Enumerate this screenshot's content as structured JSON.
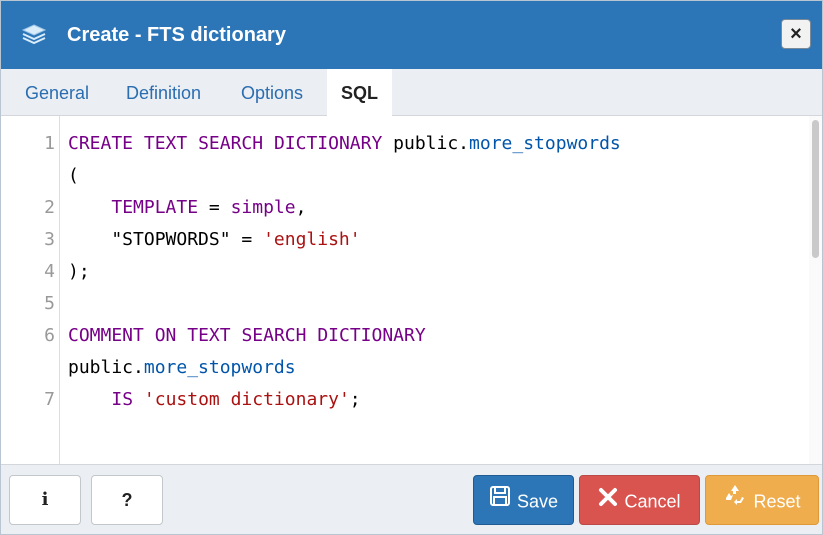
{
  "dialog": {
    "title": "Create - FTS dictionary",
    "close_label": "×"
  },
  "tabs": [
    {
      "label": "General"
    },
    {
      "label": "Definition"
    },
    {
      "label": "Options"
    },
    {
      "label": "SQL",
      "active": true
    }
  ],
  "editor": {
    "line_numbers": [
      "1",
      "2",
      "3",
      "4",
      "5",
      "6",
      "7"
    ],
    "lines": [
      "CREATE TEXT SEARCH DICTIONARY public.more_stopwords",
      "(",
      "    TEMPLATE = simple,",
      "    \"STOPWORDS\" = 'english'",
      ");",
      "",
      "COMMENT ON TEXT SEARCH DICTIONARY",
      "public.more_stopwords",
      "    IS 'custom dictionary';"
    ]
  },
  "footer": {
    "info_label": "i",
    "help_label": "?",
    "save_label": "Save",
    "cancel_label": "Cancel",
    "reset_label": "Reset"
  },
  "colors": {
    "titlebar": "#2c76b8",
    "keyword": "#770088",
    "string": "#aa1111",
    "definition": "#0055aa",
    "save": "#2c76b8",
    "cancel": "#d9534f",
    "reset": "#f0ad4e"
  },
  "icons": {
    "title": "fts-dictionary-icon",
    "close": "close-icon",
    "save": "save-icon",
    "cancel": "cancel-icon",
    "reset": "reset-icon"
  }
}
